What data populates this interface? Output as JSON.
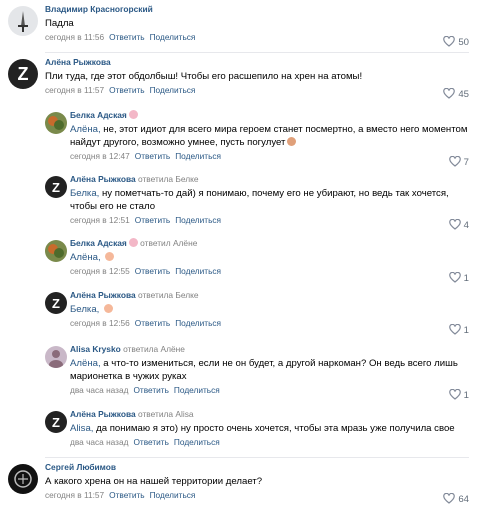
{
  "comments": [
    {
      "author": "Владимир Красногорский",
      "reply_prefix": "",
      "reply_to": "",
      "text_addr": "",
      "text": "Падла",
      "time": "сегодня в 11:56",
      "reply": "Ответить",
      "share": "Поделиться",
      "likes": "50",
      "avatar": "sword-avatar-icon"
    },
    {
      "author": "Алёна Рыжкова",
      "reply_prefix": "",
      "reply_to": "",
      "text_addr": "",
      "text": "Пли туда, где этот обдолбыш! Чтобы его расшепило на хрен на атомы!",
      "time": "сегодня в 11:57",
      "reply": "Ответить",
      "share": "Поделиться",
      "likes": "45",
      "avatar": "z-avatar-icon"
    },
    {
      "author": "Белка Адская",
      "reply_prefix": "",
      "reply_to": "",
      "text_addr": "Алёна,",
      "text": " не, этот идиот для всего мира героем станет посмертно, а вместо него моментом найдут другого, возможно умнее, пусть погулует",
      "time": "сегодня в 12:47",
      "reply": "Ответить",
      "share": "Поделиться",
      "likes": "7",
      "avatar": "leaves-avatar-icon"
    },
    {
      "author": "Алёна Рыжкова",
      "reply_prefix": "ответила",
      "reply_to": "Белке",
      "text_addr": "Белка,",
      "text": " ну пометчать-то дай) я понимаю, почему его не убирают, но ведь так хочется, чтобы его не стало",
      "time": "сегодня в 12:51",
      "reply": "Ответить",
      "share": "Поделиться",
      "likes": "4",
      "avatar": "z-avatar-icon"
    },
    {
      "author": "Белка Адская",
      "reply_prefix": "ответил",
      "reply_to": "Алёне",
      "text_addr": "Алёна,",
      "text": "",
      "time": "сегодня в 12:55",
      "reply": "Ответить",
      "share": "Поделиться",
      "likes": "1",
      "avatar": "leaves-avatar-icon"
    },
    {
      "author": "Алёна Рыжкова",
      "reply_prefix": "ответила",
      "reply_to": "Белке",
      "text_addr": "Белка,",
      "text": "",
      "time": "сегодня в 12:56",
      "reply": "Ответить",
      "share": "Поделиться",
      "likes": "1",
      "avatar": "z-avatar-icon"
    },
    {
      "author": "Alisa Krysko",
      "reply_prefix": "ответила",
      "reply_to": "Алёне",
      "text_addr": "Алёна,",
      "text": " а что-то измениться, если не он будет, а другой наркоман? Он ведь всего лишь марионетка в чужих руках",
      "time": "два часа назад",
      "reply": "Ответить",
      "share": "Поделиться",
      "likes": "1",
      "avatar": "person-avatar-icon"
    },
    {
      "author": "Алёна Рыжкова",
      "reply_prefix": "ответила",
      "reply_to": "Alisa",
      "text_addr": "Alisa,",
      "text": " да понимаю я это) ну просто очень хочется, чтобы эта мразь уже получила свое",
      "time": "два часа назад",
      "reply": "Ответить",
      "share": "Поделиться",
      "likes": "",
      "avatar": "z-avatar-icon"
    },
    {
      "author": "Сергей Любимов",
      "reply_prefix": "",
      "reply_to": "",
      "text_addr": "",
      "text": "А какого хрена он на нашей территории делает?",
      "time": "сегодня в 11:57",
      "reply": "Ответить",
      "share": "Поделиться",
      "likes": "64",
      "avatar": "dark-avatar-icon"
    }
  ]
}
